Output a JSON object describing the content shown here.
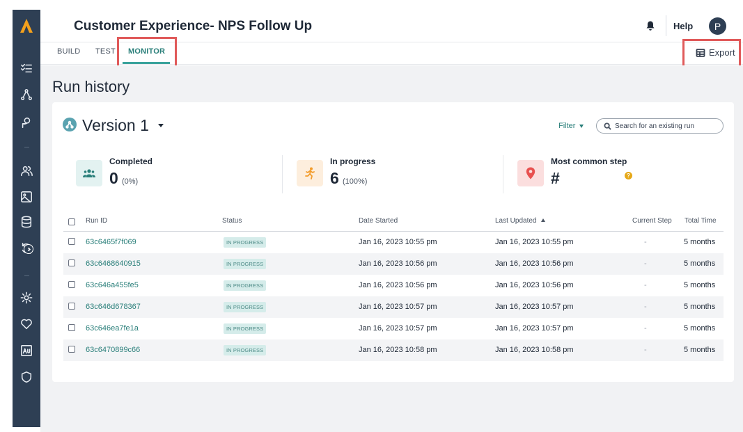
{
  "header": {
    "title": "Customer Experience- NPS Follow Up",
    "help_label": "Help",
    "avatar_initial": "P"
  },
  "tabs": [
    {
      "label": "BUILD",
      "active": false
    },
    {
      "label": "TEST",
      "active": false
    },
    {
      "label": "MONITOR",
      "active": true
    }
  ],
  "toolbar": {
    "export_label": "Export"
  },
  "main": {
    "section_title": "Run history",
    "version_label": "Version 1",
    "filter_label": "Filter",
    "search_placeholder": "Search for an existing run"
  },
  "stats": [
    {
      "label": "Completed",
      "value": "0",
      "pct": "(0%)",
      "icon": "users-icon",
      "color": "#e3f2f1"
    },
    {
      "label": "In progress",
      "value": "6",
      "pct": "(100%)",
      "icon": "runner-icon",
      "color": "#fdeedd"
    },
    {
      "label": "Most common step",
      "value": "#",
      "pct": "",
      "icon": "map-pin-icon",
      "color": "#fbdede"
    }
  ],
  "table": {
    "columns": [
      "Run ID",
      "Status",
      "Date Started",
      "Last Updated",
      "Current Step",
      "Total Time"
    ],
    "sorted_column": "Last Updated",
    "rows": [
      {
        "id": "63c6465f7f069",
        "status": "IN PROGRESS",
        "started": "Jan 16, 2023 10:55 pm",
        "updated": "Jan 16, 2023 10:55 pm",
        "step": "-",
        "total": "5 months"
      },
      {
        "id": "63c6468640915",
        "status": "IN PROGRESS",
        "started": "Jan 16, 2023 10:56 pm",
        "updated": "Jan 16, 2023 10:56 pm",
        "step": "-",
        "total": "5 months"
      },
      {
        "id": "63c646a455fe5",
        "status": "IN PROGRESS",
        "started": "Jan 16, 2023 10:56 pm",
        "updated": "Jan 16, 2023 10:56 pm",
        "step": "-",
        "total": "5 months"
      },
      {
        "id": "63c646d678367",
        "status": "IN PROGRESS",
        "started": "Jan 16, 2023 10:57 pm",
        "updated": "Jan 16, 2023 10:57 pm",
        "step": "-",
        "total": "5 months"
      },
      {
        "id": "63c646ea7fe1a",
        "status": "IN PROGRESS",
        "started": "Jan 16, 2023 10:57 pm",
        "updated": "Jan 16, 2023 10:57 pm",
        "step": "-",
        "total": "5 months"
      },
      {
        "id": "63c6470899c66",
        "status": "IN PROGRESS",
        "started": "Jan 16, 2023 10:58 pm",
        "updated": "Jan 16, 2023 10:58 pm",
        "step": "-",
        "total": "5 months"
      }
    ]
  },
  "colors": {
    "sidebar": "#2e3f54",
    "accent": "#2a7f7a",
    "logo": "#f4a11c",
    "highlight": "#e05a5a"
  }
}
